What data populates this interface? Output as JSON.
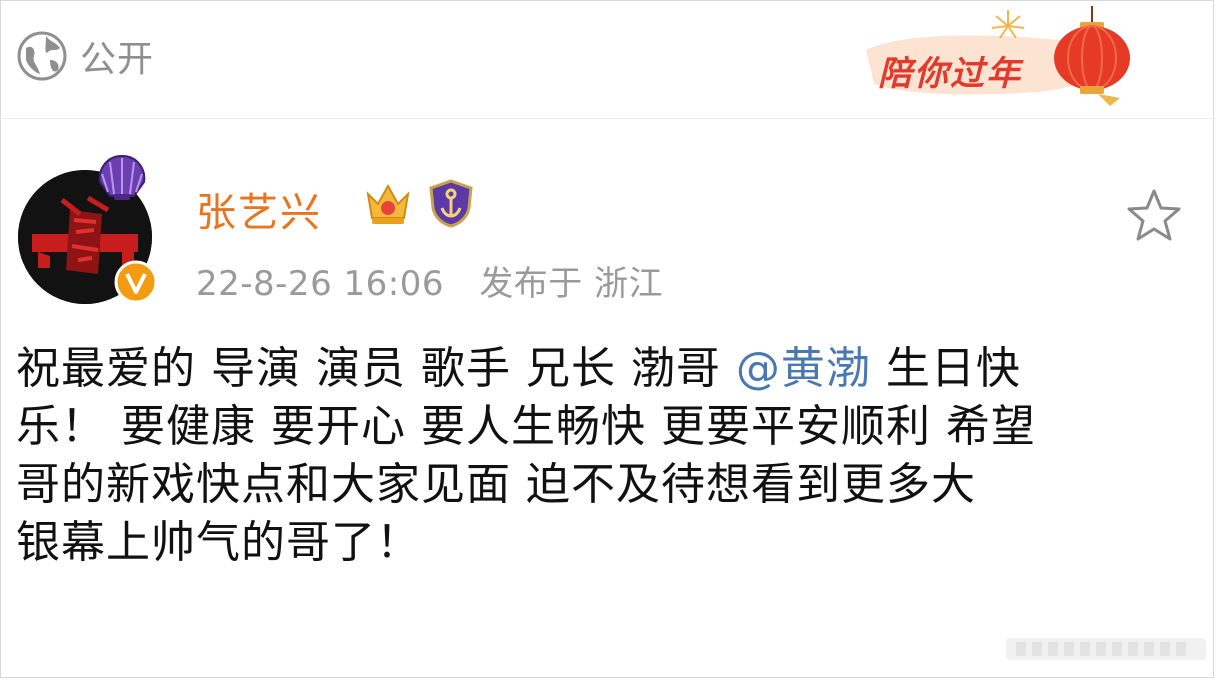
{
  "topbar": {
    "visibility_label": "公开",
    "festival_text": "陪你过年"
  },
  "post": {
    "author": "张艺兴",
    "timestamp": "22-8-26 16:06",
    "location": "发布于 浙江",
    "lines": [
      {
        "before": "祝最爱的 导演 演员 歌手 兄长 渤哥 ",
        "mention": "@黄渤",
        "after": " 生日快"
      },
      {
        "text": "乐！ 要健康 要开心 要人生畅快 更要平安顺利 希望"
      },
      {
        "text": "哥的新戏快点和大家见面  迫不及待想看到更多大"
      },
      {
        "text": "银幕上帅气的哥了！"
      }
    ]
  },
  "icons": {
    "visibility": "globe-icon",
    "favorite": "star-icon",
    "verified": "verified-v-icon",
    "member": "crown-icon",
    "fan_badge": "anchor-shield-icon",
    "avatar_badge": "shell-icon",
    "festival": "lantern-icon"
  },
  "colors": {
    "username": "#e8741f",
    "mention": "#4a78b0",
    "meta": "#9a9a9a",
    "festival": "#e23b2e",
    "verified": "#f39c12"
  }
}
